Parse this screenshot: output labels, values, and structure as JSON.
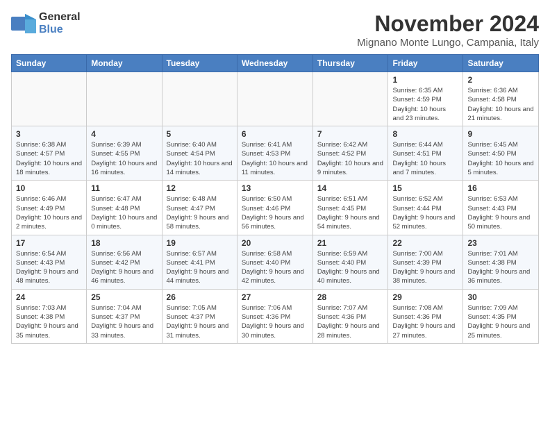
{
  "header": {
    "logo_line1": "General",
    "logo_line2": "Blue",
    "month": "November 2024",
    "location": "Mignano Monte Lungo, Campania, Italy"
  },
  "weekdays": [
    "Sunday",
    "Monday",
    "Tuesday",
    "Wednesday",
    "Thursday",
    "Friday",
    "Saturday"
  ],
  "weeks": [
    [
      {
        "day": "",
        "info": ""
      },
      {
        "day": "",
        "info": ""
      },
      {
        "day": "",
        "info": ""
      },
      {
        "day": "",
        "info": ""
      },
      {
        "day": "",
        "info": ""
      },
      {
        "day": "1",
        "info": "Sunrise: 6:35 AM\nSunset: 4:59 PM\nDaylight: 10 hours and 23 minutes."
      },
      {
        "day": "2",
        "info": "Sunrise: 6:36 AM\nSunset: 4:58 PM\nDaylight: 10 hours and 21 minutes."
      }
    ],
    [
      {
        "day": "3",
        "info": "Sunrise: 6:38 AM\nSunset: 4:57 PM\nDaylight: 10 hours and 18 minutes."
      },
      {
        "day": "4",
        "info": "Sunrise: 6:39 AM\nSunset: 4:55 PM\nDaylight: 10 hours and 16 minutes."
      },
      {
        "day": "5",
        "info": "Sunrise: 6:40 AM\nSunset: 4:54 PM\nDaylight: 10 hours and 14 minutes."
      },
      {
        "day": "6",
        "info": "Sunrise: 6:41 AM\nSunset: 4:53 PM\nDaylight: 10 hours and 11 minutes."
      },
      {
        "day": "7",
        "info": "Sunrise: 6:42 AM\nSunset: 4:52 PM\nDaylight: 10 hours and 9 minutes."
      },
      {
        "day": "8",
        "info": "Sunrise: 6:44 AM\nSunset: 4:51 PM\nDaylight: 10 hours and 7 minutes."
      },
      {
        "day": "9",
        "info": "Sunrise: 6:45 AM\nSunset: 4:50 PM\nDaylight: 10 hours and 5 minutes."
      }
    ],
    [
      {
        "day": "10",
        "info": "Sunrise: 6:46 AM\nSunset: 4:49 PM\nDaylight: 10 hours and 2 minutes."
      },
      {
        "day": "11",
        "info": "Sunrise: 6:47 AM\nSunset: 4:48 PM\nDaylight: 10 hours and 0 minutes."
      },
      {
        "day": "12",
        "info": "Sunrise: 6:48 AM\nSunset: 4:47 PM\nDaylight: 9 hours and 58 minutes."
      },
      {
        "day": "13",
        "info": "Sunrise: 6:50 AM\nSunset: 4:46 PM\nDaylight: 9 hours and 56 minutes."
      },
      {
        "day": "14",
        "info": "Sunrise: 6:51 AM\nSunset: 4:45 PM\nDaylight: 9 hours and 54 minutes."
      },
      {
        "day": "15",
        "info": "Sunrise: 6:52 AM\nSunset: 4:44 PM\nDaylight: 9 hours and 52 minutes."
      },
      {
        "day": "16",
        "info": "Sunrise: 6:53 AM\nSunset: 4:43 PM\nDaylight: 9 hours and 50 minutes."
      }
    ],
    [
      {
        "day": "17",
        "info": "Sunrise: 6:54 AM\nSunset: 4:43 PM\nDaylight: 9 hours and 48 minutes."
      },
      {
        "day": "18",
        "info": "Sunrise: 6:56 AM\nSunset: 4:42 PM\nDaylight: 9 hours and 46 minutes."
      },
      {
        "day": "19",
        "info": "Sunrise: 6:57 AM\nSunset: 4:41 PM\nDaylight: 9 hours and 44 minutes."
      },
      {
        "day": "20",
        "info": "Sunrise: 6:58 AM\nSunset: 4:40 PM\nDaylight: 9 hours and 42 minutes."
      },
      {
        "day": "21",
        "info": "Sunrise: 6:59 AM\nSunset: 4:40 PM\nDaylight: 9 hours and 40 minutes."
      },
      {
        "day": "22",
        "info": "Sunrise: 7:00 AM\nSunset: 4:39 PM\nDaylight: 9 hours and 38 minutes."
      },
      {
        "day": "23",
        "info": "Sunrise: 7:01 AM\nSunset: 4:38 PM\nDaylight: 9 hours and 36 minutes."
      }
    ],
    [
      {
        "day": "24",
        "info": "Sunrise: 7:03 AM\nSunset: 4:38 PM\nDaylight: 9 hours and 35 minutes."
      },
      {
        "day": "25",
        "info": "Sunrise: 7:04 AM\nSunset: 4:37 PM\nDaylight: 9 hours and 33 minutes."
      },
      {
        "day": "26",
        "info": "Sunrise: 7:05 AM\nSunset: 4:37 PM\nDaylight: 9 hours and 31 minutes."
      },
      {
        "day": "27",
        "info": "Sunrise: 7:06 AM\nSunset: 4:36 PM\nDaylight: 9 hours and 30 minutes."
      },
      {
        "day": "28",
        "info": "Sunrise: 7:07 AM\nSunset: 4:36 PM\nDaylight: 9 hours and 28 minutes."
      },
      {
        "day": "29",
        "info": "Sunrise: 7:08 AM\nSunset: 4:36 PM\nDaylight: 9 hours and 27 minutes."
      },
      {
        "day": "30",
        "info": "Sunrise: 7:09 AM\nSunset: 4:35 PM\nDaylight: 9 hours and 25 minutes."
      }
    ]
  ]
}
